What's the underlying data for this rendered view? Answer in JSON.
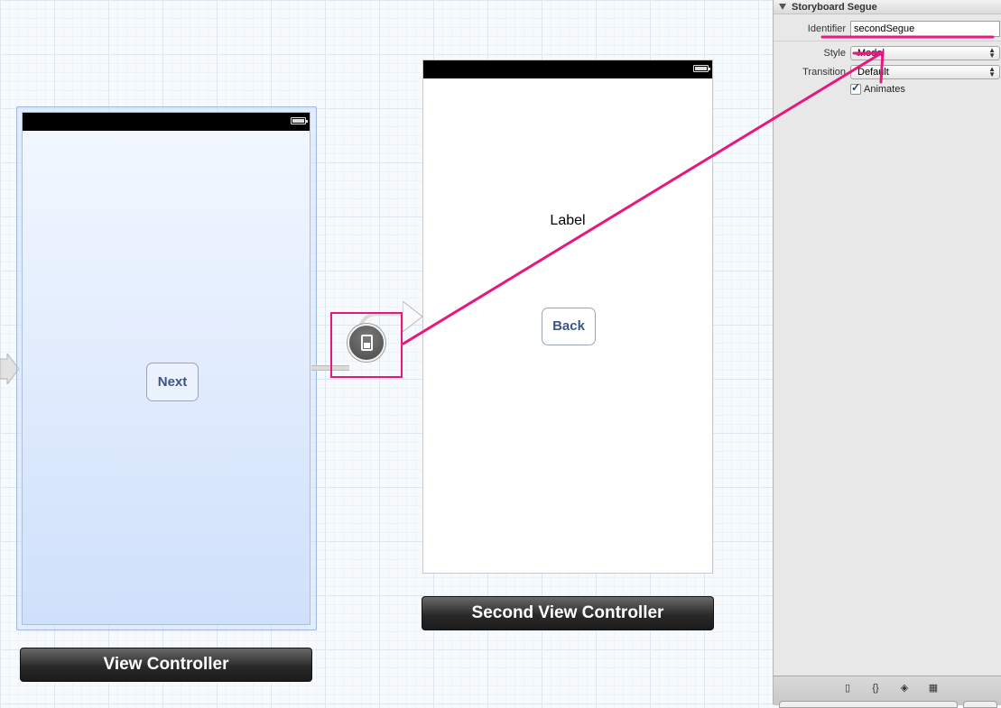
{
  "canvas": {
    "scene1": {
      "button_label": "Next",
      "title": "View Controller"
    },
    "scene2": {
      "label_text": "Label",
      "button_label": "Back",
      "title": "Second View Controller"
    }
  },
  "inspector": {
    "section_title": "Storyboard Segue",
    "identifier": {
      "label": "Identifier",
      "value": "secondSegue"
    },
    "style": {
      "label": "Style",
      "value": "Modal"
    },
    "transition": {
      "label": "Transition",
      "value": "Default"
    },
    "animates": {
      "label": "Animates",
      "checked": true
    },
    "bottom_tabs": [
      {
        "icon": "file-icon",
        "glyph": "▯"
      },
      {
        "icon": "braces-icon",
        "glyph": "{}"
      },
      {
        "icon": "cube-icon",
        "glyph": "◈"
      },
      {
        "icon": "grid-icon",
        "glyph": "▦"
      }
    ]
  },
  "colors": {
    "annotation": "#e8177f",
    "button_text": "#3b5686",
    "scene_bar": "#2a2a2a"
  }
}
